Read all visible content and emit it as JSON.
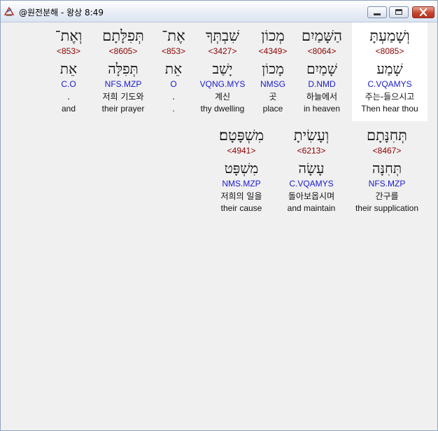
{
  "window": {
    "title": "@원전분해 - 왕상 8:49"
  },
  "rows": [
    {
      "words": [
        {
          "surface": "וְשָׁמַעְתָּ",
          "strong": "<8085>",
          "lemma": "שָׁמַע",
          "morph": "C.VQAMYS",
          "korean": "주는-들으시고",
          "english": "Then hear thou"
        },
        {
          "surface": "הַשָּׁמַיִם",
          "strong": "<8064>",
          "lemma": "שָׁמַיִם",
          "morph": "D.NMD",
          "korean": "하늘에서",
          "english": "in heaven"
        },
        {
          "surface": "מְכוֹן",
          "strong": "<4349>",
          "lemma": "מָכוֹן",
          "morph": "NMSG",
          "korean": "곳",
          "english": "place"
        },
        {
          "surface": "שִׁבְתְּךָ",
          "strong": "<3427>",
          "lemma": "יָשַׁב",
          "morph": "VQNG.MYS",
          "korean": "계신",
          "english": "thy dwelling"
        },
        {
          "surface": "אֶת־",
          "strong": "<853>",
          "lemma": "אֵת",
          "morph": "O",
          "korean": ".",
          "english": "."
        },
        {
          "surface": "תְּפִלָּתָם",
          "strong": "<8605>",
          "lemma": "תְּפִלָּה",
          "morph": "NFS.MZP",
          "korean": "저희 기도와",
          "english": "their prayer"
        },
        {
          "surface": "וְאֶת־",
          "strong": "<853>",
          "lemma": "אֵת",
          "morph": "C.O",
          "korean": ".",
          "english": "and"
        }
      ]
    },
    {
      "words": [
        {
          "surface": "תְּחִנָּתָם",
          "strong": "<8467>",
          "lemma": "תְּחִנָּה",
          "morph": "NFS.MZP",
          "korean": "간구를",
          "english": "their supplication"
        },
        {
          "surface": "וְעָשִׂיתָ",
          "strong": "<6213>",
          "lemma": "עָשָׂה",
          "morph": "C.VQAMYS",
          "korean": "돌아보옵시며",
          "english": "and maintain"
        },
        {
          "surface": "מִשְׁפָּטָם׃",
          "strong": "<4941>",
          "lemma": "מִשְׁפָּט",
          "morph": "NMS.MZP",
          "korean": "저희의 일을",
          "english": "their cause"
        }
      ]
    }
  ],
  "colors": {
    "strong": "#8b0000",
    "morph": "#1a1acc",
    "text": "#111111",
    "highlight": "#ffffff"
  },
  "icons": {
    "app": "bible-app-icon",
    "minimize": "minimize-icon",
    "maximize": "maximize-icon",
    "close": "close-icon"
  }
}
